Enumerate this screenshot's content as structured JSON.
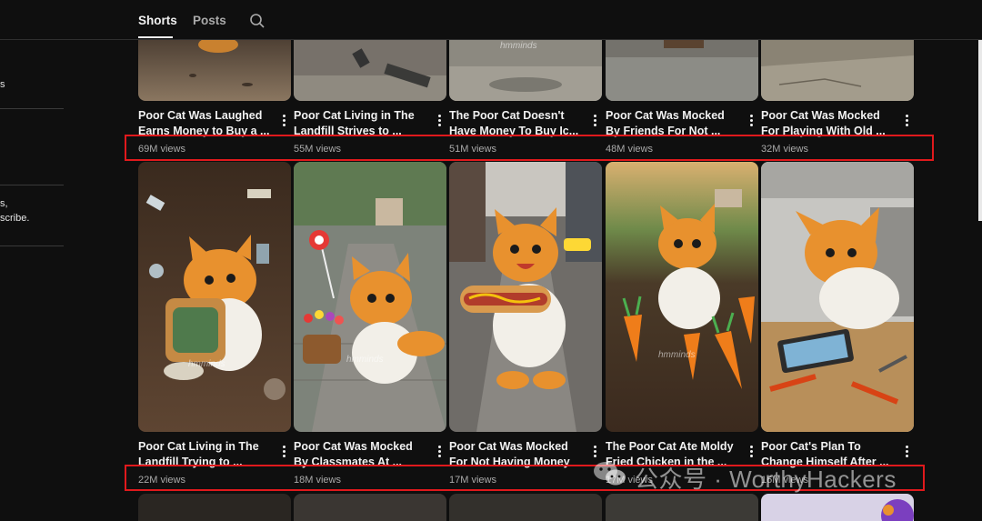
{
  "tabs": [
    {
      "label": "Shorts",
      "active": true
    },
    {
      "label": "Posts",
      "active": false
    }
  ],
  "sidebar": {
    "snippets": [
      "s",
      "s,",
      "scribe."
    ]
  },
  "shorts": [
    {
      "title": "Poor Cat Was Laughed Earns Money to Buy a ...",
      "views": "69M views",
      "palette": [
        "#5a4a3a",
        "#8a7660"
      ]
    },
    {
      "title": "Poor Cat Living in The Landfill Strives to ...",
      "views": "55M views",
      "palette": [
        "#6a6560",
        "#8f8a80"
      ]
    },
    {
      "title": "The Poor Cat Doesn't Have Money To Buy Ic...",
      "views": "51M views",
      "palette": [
        "#7a7870",
        "#a29e94"
      ],
      "watermark": "hmminds"
    },
    {
      "title": "Poor Cat Was Mocked By Friends For Not ...",
      "views": "48M views",
      "palette": [
        "#666660",
        "#8c8c86"
      ]
    },
    {
      "title": "Poor Cat Was Mocked For Playing With Old ...",
      "views": "32M views",
      "palette": [
        "#7a7466",
        "#a39c8c"
      ]
    },
    {
      "title": "Poor Cat Living in The Landfill Trying to ...",
      "views": "22M views",
      "watermark": "hmminds",
      "prop": "bread"
    },
    {
      "title": "Poor Cat Was Mocked By Classmates At ...",
      "views": "18M views",
      "watermark": "hmminds",
      "prop": "lollipop"
    },
    {
      "title": "Poor Cat Was Mocked For Not Having Money ...",
      "views": "17M views",
      "watermark": "hmminds",
      "prop": "hotdog"
    },
    {
      "title": "The Poor Cat Ate Moldy Fried Chicken in the ...",
      "views": "17M views",
      "watermark": "hmminds",
      "prop": "carrots"
    },
    {
      "title": "Poor Cat's Plan To Change Himself After ...",
      "views": "16M views",
      "watermark": "hmminds",
      "prop": "tools"
    }
  ],
  "overlay_watermark": "公众号 · WorthyHackers",
  "colors": {
    "highlight": "#e0191c",
    "background": "#0f0f0f",
    "kitten": "#e8912e"
  }
}
